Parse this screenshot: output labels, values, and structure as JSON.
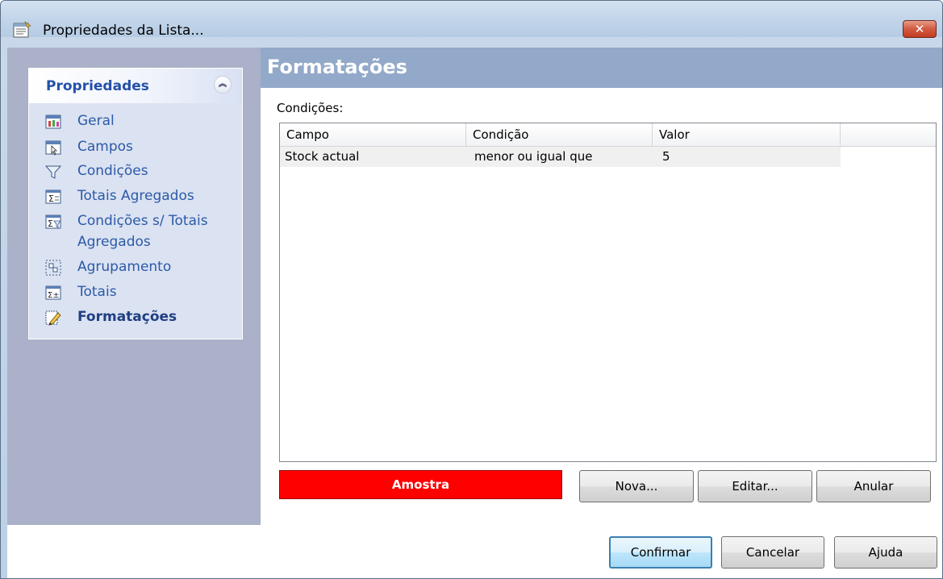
{
  "window": {
    "title": "Propriedades da Lista...",
    "close_label": "✕"
  },
  "sidebar": {
    "panel_title": "Propriedades",
    "collapse_glyph": "︽",
    "items": [
      {
        "label": "Geral",
        "icon": "general-properties-icon",
        "active": false
      },
      {
        "label": "Campos",
        "icon": "fields-icon",
        "active": false
      },
      {
        "label": "Condições",
        "icon": "funnel-filter-icon",
        "active": false
      },
      {
        "label": "Totais Agregados",
        "icon": "sigma-aggregate-icon",
        "active": false
      },
      {
        "label": "Condições s/ Totais",
        "label2": "Agregados",
        "icon": "sigma-condition-icon",
        "active": false
      },
      {
        "label": "Agrupamento",
        "icon": "grouping-icon",
        "active": false
      },
      {
        "label": "Totais",
        "icon": "totals-icon",
        "active": false
      },
      {
        "label": "Formatações",
        "icon": "formatting-pencil-icon",
        "active": true
      }
    ]
  },
  "main": {
    "heading": "Formatações",
    "conditions_label": "Condições:",
    "columns": [
      "Campo",
      "Condição",
      "Valor"
    ],
    "rows": [
      {
        "campo": "Stock actual",
        "condicao": "menor ou igual que",
        "valor": "5"
      }
    ],
    "sample_label": "Amostra",
    "sample_color": "#ff0000",
    "buttons": {
      "nova": "Nova...",
      "editar": "Editar...",
      "anular": "Anular"
    }
  },
  "footer": {
    "confirmar": "Confirmar",
    "cancelar": "Cancelar",
    "ajuda": "Ajuda"
  }
}
